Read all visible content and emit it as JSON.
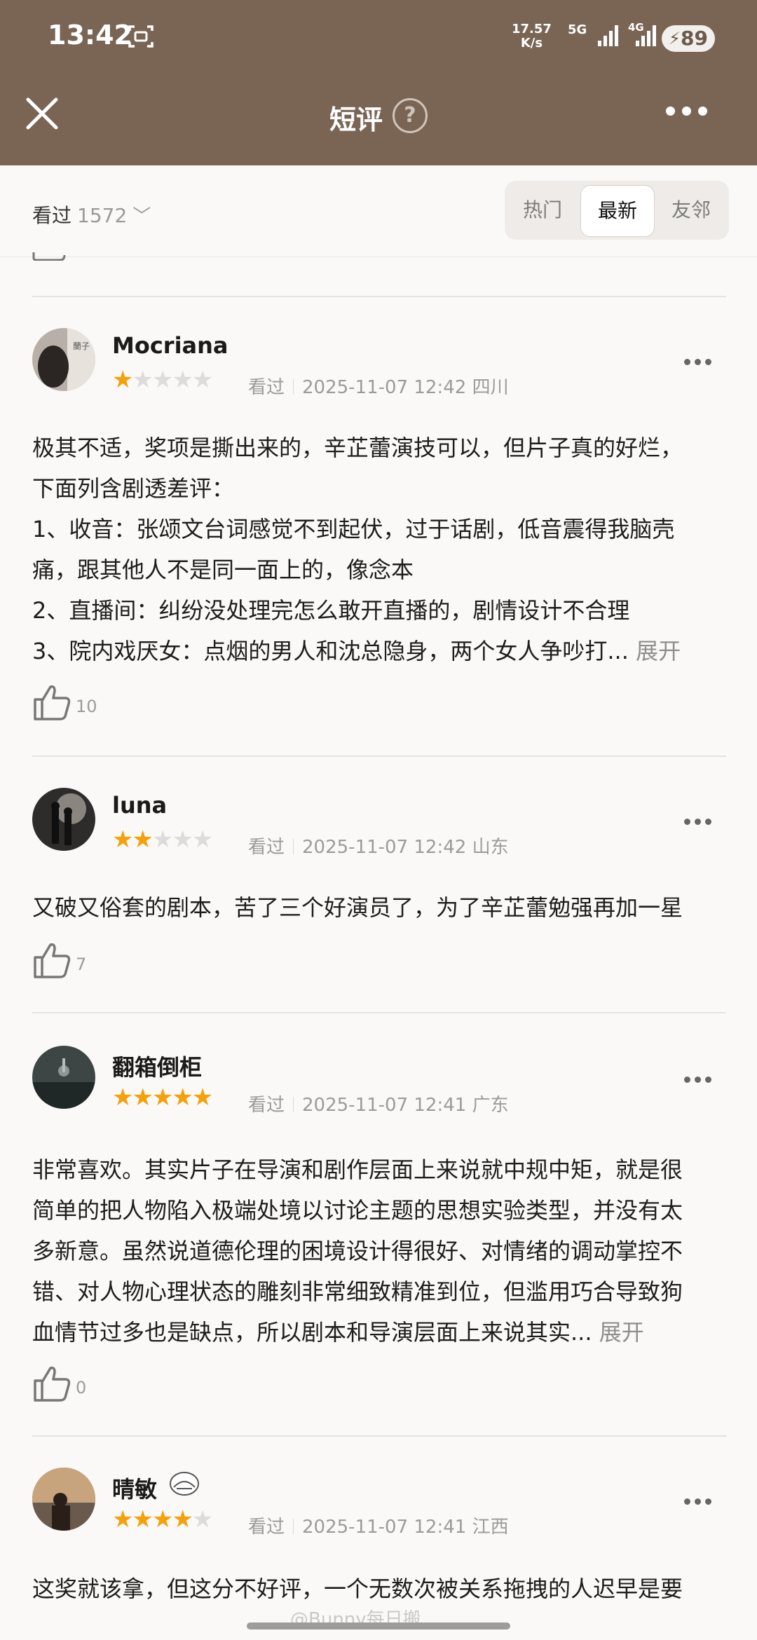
{
  "status_bar": {
    "time": "13:42",
    "speed_value": "17.57",
    "speed_unit": "K/s",
    "net1": "5G",
    "net2": "4G",
    "battery": "89"
  },
  "nav": {
    "title": "短评",
    "help": "?"
  },
  "filter": {
    "label": "看过",
    "count": "1572",
    "tabs": [
      "热门",
      "最新",
      "友邻"
    ],
    "active_tab": "最新"
  },
  "reviews": [
    {
      "user": "Mocriana",
      "stars": 1,
      "status": "看过",
      "date": "2025-11-07 12:42",
      "region": "四川",
      "lines": [
        "极其不适，奖项是撕出来的，辛芷蕾演技可以，但片子真的好烂，",
        "下面列含剧透差评：",
        "1、收音：张颂文台词感觉不到起伏，过于话剧，低音震得我脑壳",
        "痛，跟其他人不是同一面上的，像念本",
        "2、直播间：纠纷没处理完怎么敢开直播的，剧情设计不合理",
        "3、院内戏厌女：点烟的男人和沈总隐身，两个女人争吵打..."
      ],
      "expand": "展开",
      "likes": "10"
    },
    {
      "user": "luna",
      "stars": 2,
      "status": "看过",
      "date": "2025-11-07 12:42",
      "region": "山东",
      "lines": [
        "又破又俗套的剧本，苦了三个好演员了，为了辛芷蕾勉强再加一星"
      ],
      "likes": "7"
    },
    {
      "user": "翻箱倒柜",
      "stars": 5,
      "status": "看过",
      "date": "2025-11-07 12:41",
      "region": "广东",
      "lines": [
        "非常喜欢。其实片子在导演和剧作层面上来说就中规中矩，就是很",
        "简单的把人物陷入极端处境以讨论主题的思想实验类型，并没有太",
        "多新意。虽然说道德伦理的困境设计得很好、对情绪的调动掌控不",
        "错、对人物心理状态的雕刻非常细致精准到位，但滥用巧合导致狗",
        "血情节过多也是缺点，所以剧本和导演层面上来说其实..."
      ],
      "expand": "展开",
      "likes": "0"
    },
    {
      "user": "晴敏",
      "stars": 4,
      "status": "看过",
      "date": "2025-11-07 12:41",
      "region": "江西",
      "lines": [
        "这奖就该拿，但这分不好评，一个无数次被关系拖拽的人迟早是要"
      ]
    }
  ],
  "watermark": "@Bunny每日搬",
  "colors": {
    "header": "#7a6555",
    "star": "#f4a10b",
    "background": "#fbf9f7"
  }
}
